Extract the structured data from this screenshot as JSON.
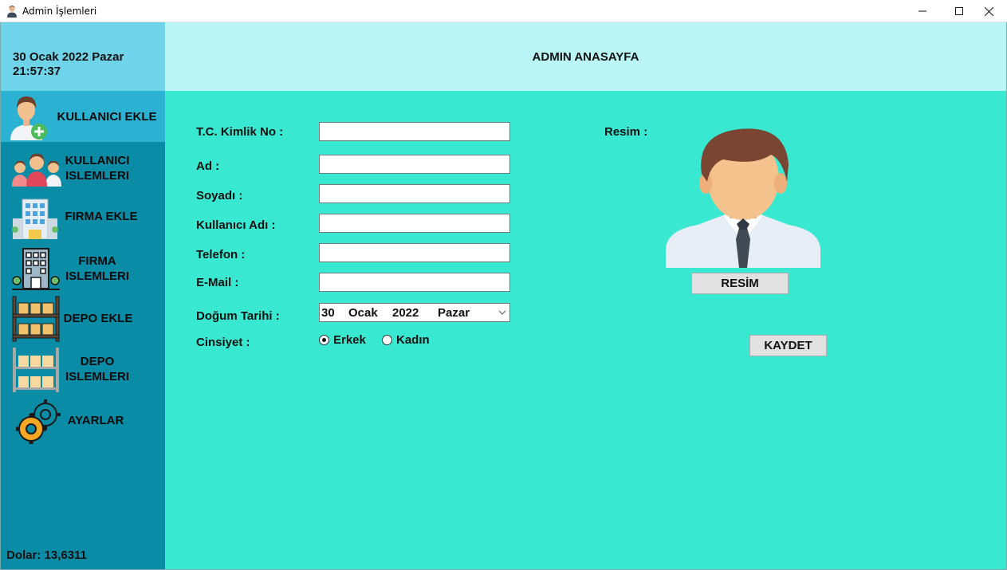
{
  "window": {
    "title": "Admin İşlemleri",
    "minimize": "—",
    "maximize": "☐",
    "close": "✕"
  },
  "sidebar": {
    "date": "30 Ocak 2022 Pazar",
    "time": "21:57:37",
    "items": [
      {
        "label_line1": "KULLANICI EKLE",
        "label_line2": "",
        "icon": "add-user-icon",
        "active": true
      },
      {
        "label_line1": "KULLANICI",
        "label_line2": "ISLEMLERI",
        "icon": "users-group-icon",
        "active": false
      },
      {
        "label_line1": "FIRMA EKLE",
        "label_line2": "",
        "icon": "office-building-icon",
        "active": false
      },
      {
        "label_line1": "FIRMA",
        "label_line2": "ISLEMLERI",
        "icon": "company-building-icon",
        "active": false
      },
      {
        "label_line1": "DEPO EKLE",
        "label_line2": "",
        "icon": "warehouse-shelf-icon",
        "active": false
      },
      {
        "label_line1": "DEPO",
        "label_line2": "ISLEMLERI",
        "icon": "storage-shelf-icon",
        "active": false
      },
      {
        "label_line1": "AYARLAR",
        "label_line2": "",
        "icon": "gear-icon",
        "active": false
      }
    ],
    "dolar": "Dolar: 13,6311"
  },
  "header": {
    "title": "ADMIN ANASAYFA"
  },
  "form": {
    "tc_label": "T.C. Kimlik No :",
    "ad_label": "Ad :",
    "soyad_label": "Soyadı :",
    "kullanici_label": "Kullanıcı Adı :",
    "telefon_label": "Telefon :",
    "email_label": "E-Mail :",
    "dogum_label": "Doğum Tarihi :",
    "cinsiyet_label": "Cinsiyet :",
    "tc_value": "",
    "ad_value": "",
    "soyad_value": "",
    "kullanici_value": "",
    "telefon_value": "",
    "email_value": "",
    "dogum": {
      "day": "30",
      "month": "Ocak",
      "year": "2022",
      "weekday": "Pazar"
    },
    "gender_options": [
      {
        "label": "Erkek",
        "checked": true
      },
      {
        "label": "Kadın",
        "checked": false
      }
    ],
    "resim_label": "Resim :",
    "resim_button": "RESİM",
    "kaydet_button": "KAYDET"
  },
  "colors": {
    "sidebar_bg": "#0a8ba6",
    "sidebar_active": "#2bb2d3",
    "date_bg": "#6fd3e9",
    "header_bg": "#bbf6f7",
    "content_bg": "#39e8d0"
  }
}
